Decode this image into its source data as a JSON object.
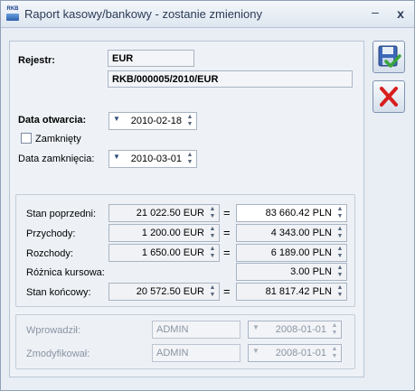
{
  "window": {
    "app_icon": "RKB",
    "title": "Raport kasowy/bankowy - zostanie zmieniony",
    "minimize_glyph": "–",
    "close_glyph": "x"
  },
  "rejestr": {
    "label": "Rejestr:",
    "code": "EUR",
    "number": "RKB/000005/2010/EUR"
  },
  "dates": {
    "open_label": "Data otwarcia:",
    "open_value": "2010-02-18",
    "closed_label": "Zamknięty",
    "closed_checked": false,
    "close_label": "Data zamknięcia:",
    "close_value": "2010-03-01"
  },
  "balances": {
    "eq_sign": "=",
    "rows": [
      {
        "label": "Stan poprzedni:",
        "amount": "21 022.50 EUR",
        "pln": "83 660.42 PLN"
      },
      {
        "label": "Przychody:",
        "amount": "1 200.00 EUR",
        "pln": "4 343.00 PLN"
      },
      {
        "label": "Rozchody:",
        "amount": "1 650.00 EUR",
        "pln": "6 189.00 PLN"
      },
      {
        "label": "Różnica kursowa:",
        "pln": "3.00 PLN"
      },
      {
        "label": "Stan końcowy:",
        "amount": "20 572.50 EUR",
        "pln": "81 817.42 PLN"
      }
    ]
  },
  "audit": {
    "entered_label": "Wprowadził:",
    "entered_user": "ADMIN",
    "entered_date": "2008-01-01",
    "modified_label": "Zmodyfikował:",
    "modified_user": "ADMIN",
    "modified_date": "2008-01-01"
  },
  "buttons": {
    "save_icon": "save-icon",
    "cancel_icon": "cancel-icon"
  },
  "colors": {
    "accent": "#2e5fae",
    "cancel_red": "#d81e1e",
    "save_green": "#3aa63a"
  }
}
